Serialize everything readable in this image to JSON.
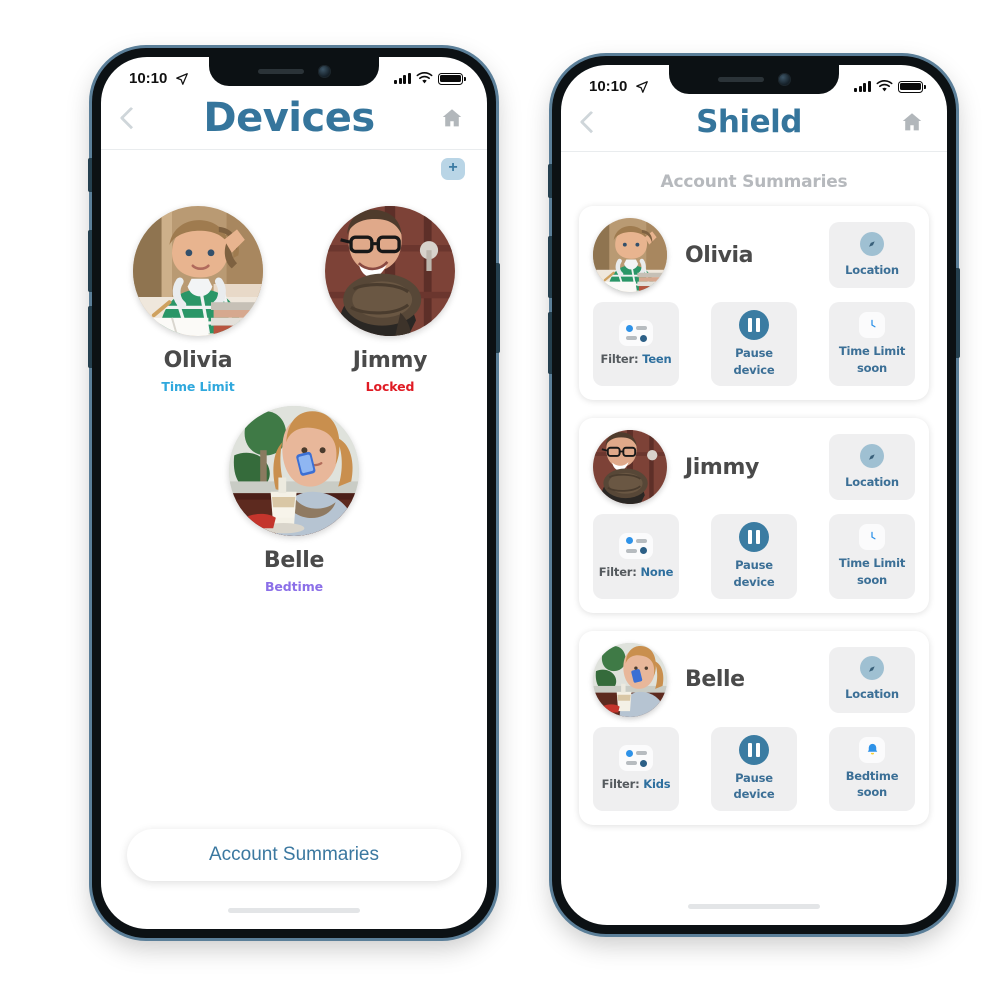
{
  "colors": {
    "title": "#35759c",
    "accent": "#3b7ca2",
    "time_limit": "#2fa8dd",
    "locked": "#e01b24",
    "bedtime": "#8b6fe8",
    "tile_bg": "#efeff0",
    "section_title": "#b6b9bd"
  },
  "left_phone": {
    "status_bar": {
      "time": "10:10",
      "location_icon": "location-arrow-icon",
      "signal_icon": "cellular-signal-icon",
      "wifi_icon": "wifi-icon",
      "battery_icon": "battery-full-icon"
    },
    "header": {
      "back_icon": "chevron-left-icon",
      "title": "Devices",
      "home_icon": "home-icon"
    },
    "add_button_label": "+",
    "devices": [
      {
        "name": "Olivia",
        "status": "Time Limit",
        "status_color": "#2fa8dd",
        "avatar": "olivia-avatar"
      },
      {
        "name": "Jimmy",
        "status": "Locked",
        "status_color": "#e01b24",
        "avatar": "jimmy-avatar"
      },
      {
        "name": "Belle",
        "status": "Bedtime",
        "status_color": "#8b6fe8",
        "avatar": "belle-avatar"
      }
    ],
    "cta_label": "Account Summaries"
  },
  "right_phone": {
    "status_bar": {
      "time": "10:10",
      "location_icon": "location-arrow-icon",
      "signal_icon": "cellular-signal-icon",
      "wifi_icon": "wifi-icon",
      "battery_icon": "battery-full-icon"
    },
    "header": {
      "back_icon": "chevron-left-icon",
      "title": "Shield",
      "home_icon": "home-icon"
    },
    "section_title": "Account Summaries",
    "cards": [
      {
        "name": "Olivia",
        "avatar": "olivia-avatar",
        "location": {
          "label": "Location",
          "icon": "compass-icon"
        },
        "filter": {
          "prefix": "Filter:",
          "value": "Teen",
          "icon": "filter-sliders-icon"
        },
        "pause": {
          "label": "Pause device",
          "icon": "pause-circle-icon"
        },
        "schedule": {
          "line1": "Time Limit",
          "line2": "soon",
          "icon": "clock-icon"
        }
      },
      {
        "name": "Jimmy",
        "avatar": "jimmy-avatar",
        "location": {
          "label": "Location",
          "icon": "compass-icon"
        },
        "filter": {
          "prefix": "Filter:",
          "value": "None",
          "icon": "filter-sliders-icon"
        },
        "pause": {
          "label": "Pause device",
          "icon": "pause-circle-icon"
        },
        "schedule": {
          "line1": "Time Limit",
          "line2": "soon",
          "icon": "clock-icon"
        }
      },
      {
        "name": "Belle",
        "avatar": "belle-avatar",
        "location": {
          "label": "Location",
          "icon": "compass-icon"
        },
        "filter": {
          "prefix": "Filter:",
          "value": "Kids",
          "icon": "filter-sliders-icon"
        },
        "pause": {
          "label": "Pause device",
          "icon": "pause-circle-icon"
        },
        "schedule": {
          "line1": "Bedtime",
          "line2": "soon",
          "icon": "bell-icon"
        }
      }
    ]
  }
}
